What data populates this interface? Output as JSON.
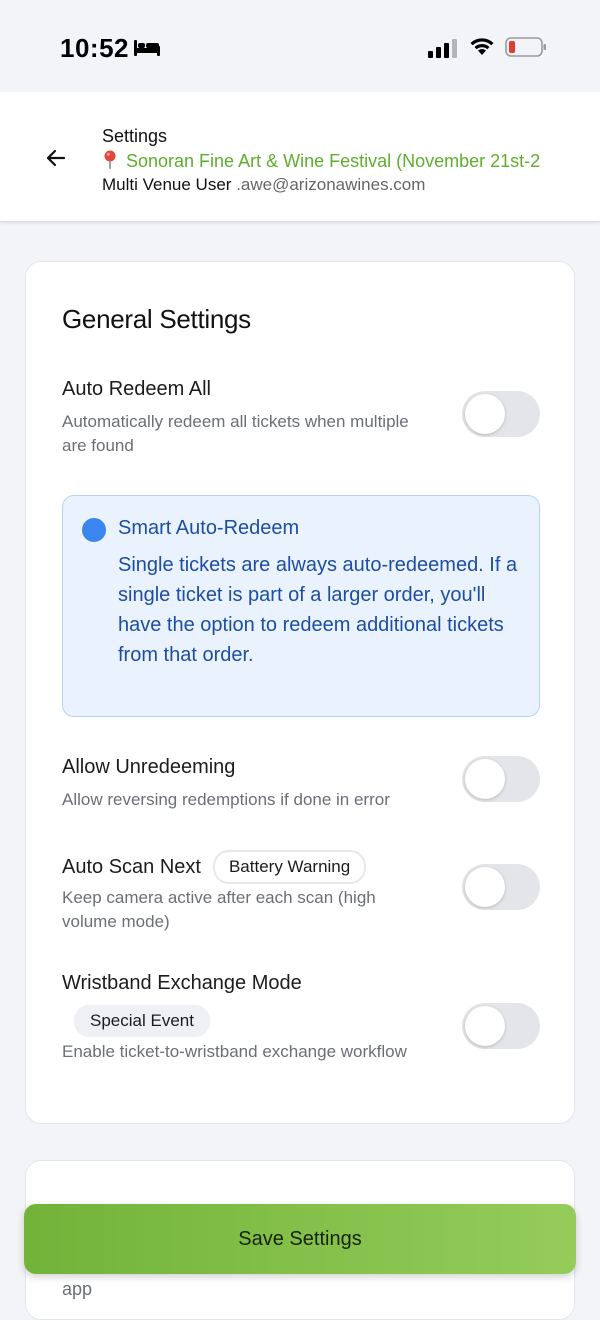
{
  "status_bar": {
    "time": "10:52",
    "icons": [
      "bed-icon",
      "signal-icon",
      "wifi-icon",
      "battery-low-icon"
    ]
  },
  "header": {
    "title": "Settings",
    "venue": "Sonoran Fine Art & Wine Festival (November 21st-2",
    "user_name": "Multi Venue User",
    "user_email": ".awe@arizonawines.com"
  },
  "general": {
    "title": "General Settings",
    "auto_redeem": {
      "label": "Auto Redeem All",
      "description": "Automatically redeem all tickets when multiple are found",
      "enabled": false
    },
    "smart_info": {
      "title": "Smart Auto-Redeem",
      "text": "Single tickets are always auto-redeemed. If a single ticket is part of a larger order, you'll have the option to redeem additional tickets from that order."
    },
    "allow_unredeem": {
      "label": "Allow Unredeeming",
      "description": "Allow reversing redemptions if done in error",
      "enabled": false
    },
    "auto_scan": {
      "label": "Auto Scan Next",
      "badge": "Battery Warning",
      "description": "Keep camera active after each scan (high volume mode)",
      "enabled": false
    },
    "wristband": {
      "label": "Wristband Exchange Mode",
      "badge": "Special Event",
      "description": "Enable ticket-to-wristband exchange workflow",
      "enabled": false
    }
  },
  "second_card": {
    "peek_text": "app"
  },
  "save_label": "Save Settings",
  "colors": {
    "accent_green": "#5fae2d",
    "info_blue": "#1d4ea3",
    "button_gradient_start": "#72b33a",
    "button_gradient_end": "#95cc5a"
  }
}
